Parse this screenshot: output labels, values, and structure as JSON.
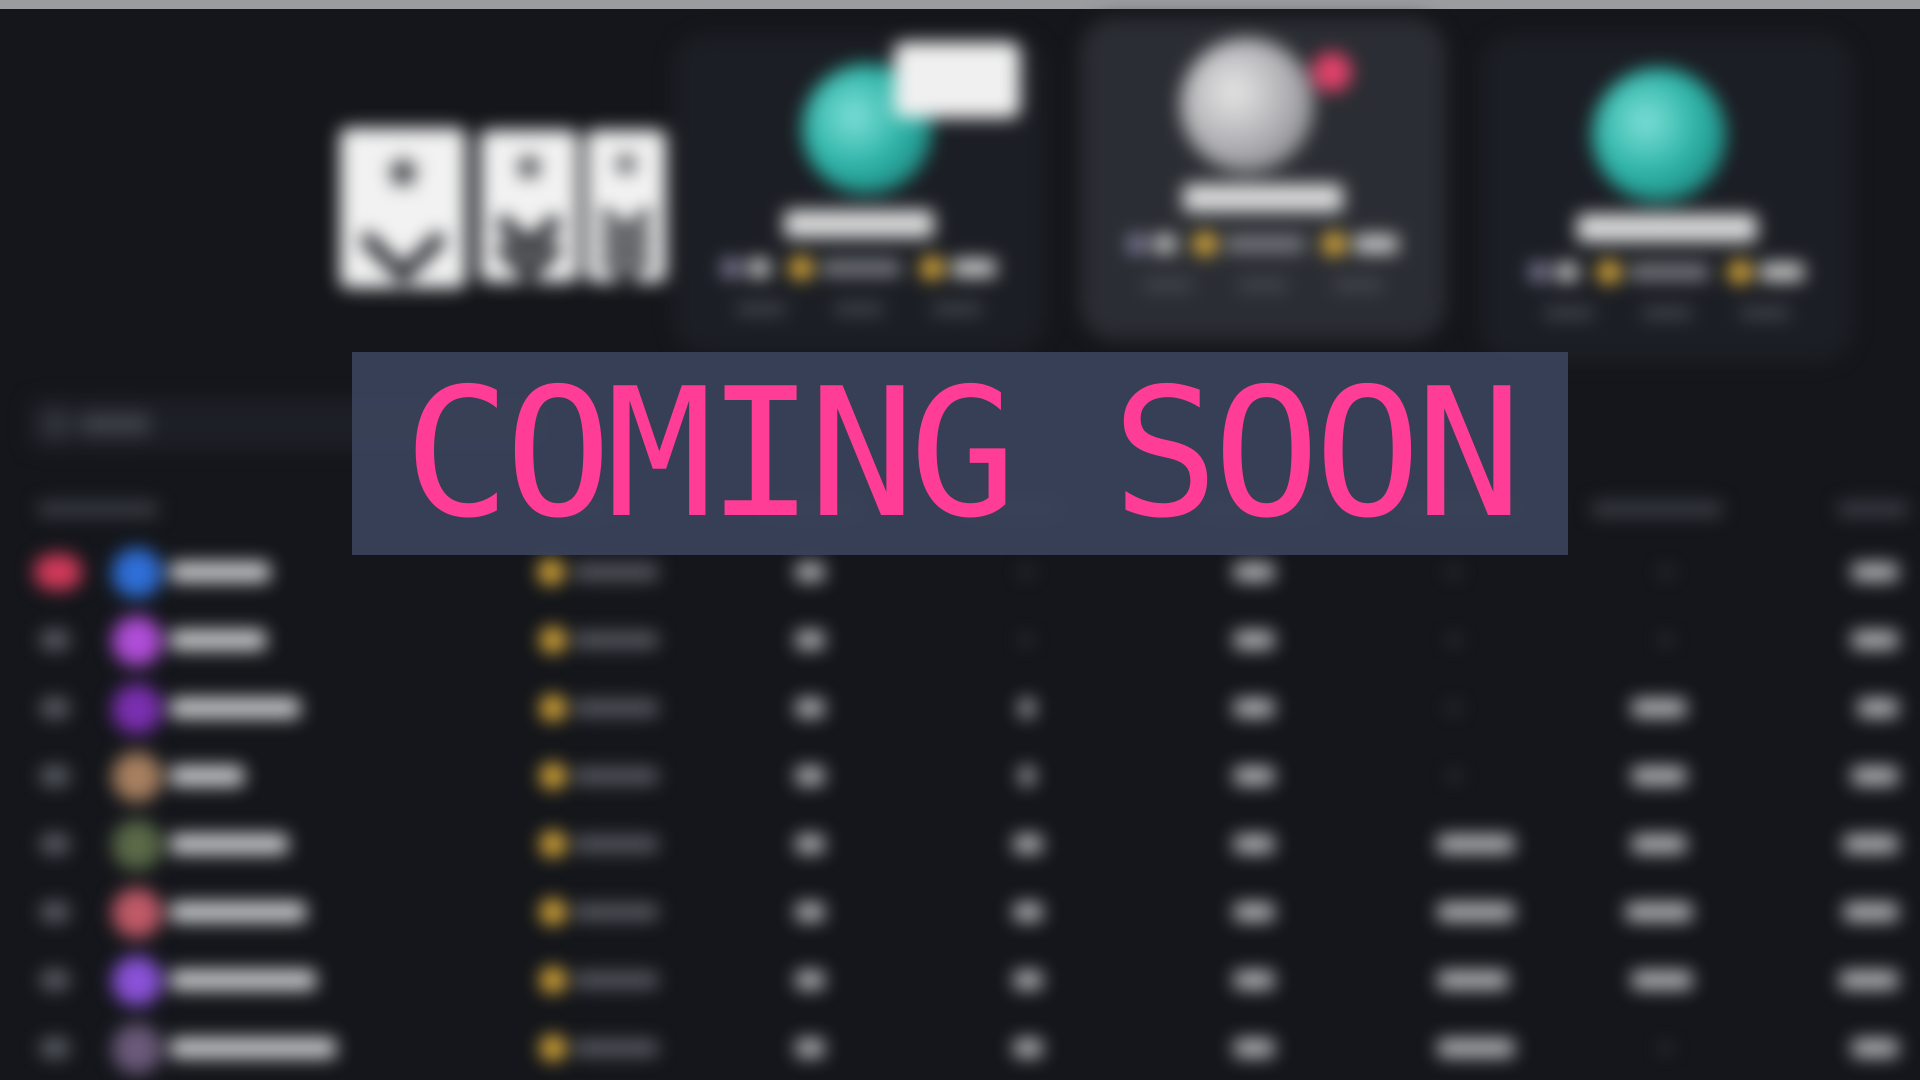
{
  "overlay": {
    "message": "COMING SOON",
    "text_color": "#ff3d96",
    "panel_color": "#3a435a"
  },
  "podium": {
    "cards": [
      {
        "position": "left",
        "avatar_icon": "globe-avatar-icon"
      },
      {
        "position": "center",
        "avatar_icon": "silver-globe-avatar-icon",
        "highlighted": true
      },
      {
        "position": "right",
        "avatar_icon": "globe-avatar-icon"
      }
    ]
  },
  "insignia": [
    "rank-insignia-1-chevron",
    "rank-insignia-2-chevron",
    "rank-insignia-3-chevron"
  ],
  "search": {
    "icon": "search-icon"
  },
  "theme": {
    "background": "#14161b",
    "rank_highlight": "#d23a5a",
    "coin": "#e3b03a"
  }
}
